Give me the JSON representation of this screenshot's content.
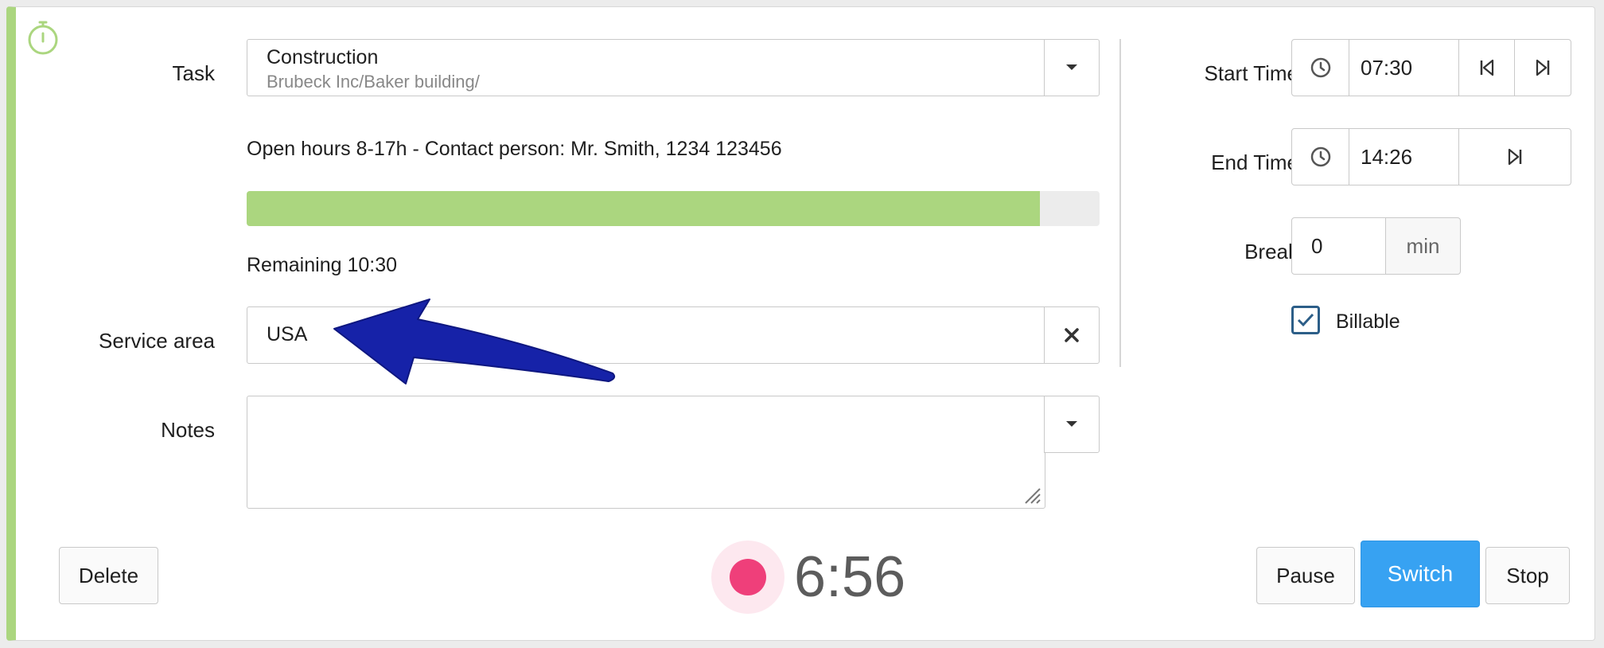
{
  "task": {
    "label": "Task",
    "title": "Construction",
    "subtitle": "Brubeck Inc/Baker building/"
  },
  "info_text": "Open hours 8-17h - Contact person: Mr. Smith, 1234 123456",
  "progress": {
    "fraction": 0.93,
    "remaining_text": "Remaining 10:30"
  },
  "service_area": {
    "label": "Service area",
    "value": "USA"
  },
  "notes": {
    "label": "Notes",
    "value": ""
  },
  "start_time": {
    "label": "Start Time",
    "value": "07:30"
  },
  "end_time": {
    "label": "End Time",
    "value": "14:26"
  },
  "break": {
    "label": "Break",
    "value": "0",
    "unit": "min"
  },
  "billable": {
    "label": "Billable",
    "checked": true
  },
  "timer": {
    "elapsed": "6:56"
  },
  "buttons": {
    "delete": "Delete",
    "pause": "Pause",
    "switch": "Switch",
    "stop": "Stop"
  },
  "colors": {
    "accent_green": "#abd67f",
    "primary_blue": "#37a2f2",
    "record_pink": "#ef3f7a",
    "annotation_arrow": "#1622a8"
  }
}
